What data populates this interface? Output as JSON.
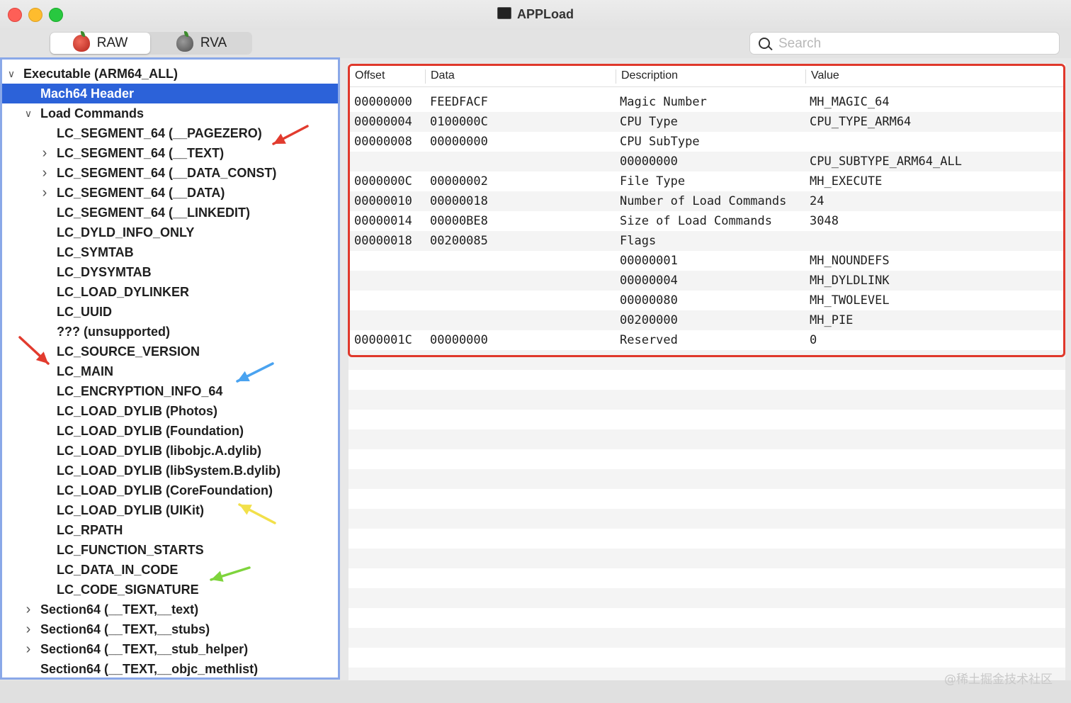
{
  "window": {
    "title": "APPLoad"
  },
  "toolbar": {
    "segments": [
      {
        "label": "RAW",
        "icon": "apple-red-icon",
        "active": true
      },
      {
        "label": "RVA",
        "icon": "apple-gray-icon",
        "active": false
      }
    ],
    "search_placeholder": "Search"
  },
  "tree": {
    "items": [
      {
        "label": "Executable  (ARM64_ALL)",
        "depth": 0,
        "chevron": "expanded"
      },
      {
        "label": "Mach64 Header",
        "depth": 1,
        "chevron": "none",
        "selected": true
      },
      {
        "label": "Load Commands",
        "depth": 1,
        "chevron": "expanded"
      },
      {
        "label": "LC_SEGMENT_64 (__PAGEZERO)",
        "depth": 2,
        "chevron": "none"
      },
      {
        "label": "LC_SEGMENT_64 (__TEXT)",
        "depth": 2,
        "chevron": "collapsed"
      },
      {
        "label": "LC_SEGMENT_64 (__DATA_CONST)",
        "depth": 2,
        "chevron": "collapsed"
      },
      {
        "label": "LC_SEGMENT_64 (__DATA)",
        "depth": 2,
        "chevron": "collapsed"
      },
      {
        "label": "LC_SEGMENT_64 (__LINKEDIT)",
        "depth": 2,
        "chevron": "none"
      },
      {
        "label": "LC_DYLD_INFO_ONLY",
        "depth": 2,
        "chevron": "none"
      },
      {
        "label": "LC_SYMTAB",
        "depth": 2,
        "chevron": "none"
      },
      {
        "label": "LC_DYSYMTAB",
        "depth": 2,
        "chevron": "none"
      },
      {
        "label": "LC_LOAD_DYLINKER",
        "depth": 2,
        "chevron": "none"
      },
      {
        "label": "LC_UUID",
        "depth": 2,
        "chevron": "none"
      },
      {
        "label": "??? (unsupported)",
        "depth": 2,
        "chevron": "none"
      },
      {
        "label": "LC_SOURCE_VERSION",
        "depth": 2,
        "chevron": "none"
      },
      {
        "label": "LC_MAIN",
        "depth": 2,
        "chevron": "none"
      },
      {
        "label": "LC_ENCRYPTION_INFO_64",
        "depth": 2,
        "chevron": "none"
      },
      {
        "label": "LC_LOAD_DYLIB (Photos)",
        "depth": 2,
        "chevron": "none"
      },
      {
        "label": "LC_LOAD_DYLIB (Foundation)",
        "depth": 2,
        "chevron": "none"
      },
      {
        "label": "LC_LOAD_DYLIB (libobjc.A.dylib)",
        "depth": 2,
        "chevron": "none"
      },
      {
        "label": "LC_LOAD_DYLIB (libSystem.B.dylib)",
        "depth": 2,
        "chevron": "none"
      },
      {
        "label": "LC_LOAD_DYLIB (CoreFoundation)",
        "depth": 2,
        "chevron": "none"
      },
      {
        "label": "LC_LOAD_DYLIB (UIKit)",
        "depth": 2,
        "chevron": "none"
      },
      {
        "label": "LC_RPATH",
        "depth": 2,
        "chevron": "none"
      },
      {
        "label": "LC_FUNCTION_STARTS",
        "depth": 2,
        "chevron": "none"
      },
      {
        "label": "LC_DATA_IN_CODE",
        "depth": 2,
        "chevron": "none"
      },
      {
        "label": "LC_CODE_SIGNATURE",
        "depth": 2,
        "chevron": "none"
      },
      {
        "label": "Section64 (__TEXT,__text)",
        "depth": 1,
        "chevron": "collapsed"
      },
      {
        "label": "Section64 (__TEXT,__stubs)",
        "depth": 1,
        "chevron": "collapsed"
      },
      {
        "label": "Section64 (__TEXT,__stub_helper)",
        "depth": 1,
        "chevron": "collapsed"
      },
      {
        "label": "Section64 (__TEXT,__objc_methlist)",
        "depth": 1,
        "chevron": "none"
      }
    ]
  },
  "table": {
    "columns": [
      "Offset",
      "Data",
      "Description",
      "Value"
    ],
    "rows": [
      [
        "00000000",
        "FEEDFACF",
        "Magic Number",
        "MH_MAGIC_64"
      ],
      [
        "00000004",
        "0100000C",
        "CPU Type",
        "CPU_TYPE_ARM64"
      ],
      [
        "00000008",
        "00000000",
        "CPU SubType",
        ""
      ],
      [
        "",
        "",
        "00000000",
        "CPU_SUBTYPE_ARM64_ALL"
      ],
      [
        "0000000C",
        "00000002",
        "File Type",
        "MH_EXECUTE"
      ],
      [
        "00000010",
        "00000018",
        "Number of Load Commands",
        "24"
      ],
      [
        "00000014",
        "00000BE8",
        "Size of Load Commands",
        "3048"
      ],
      [
        "00000018",
        "00200085",
        "Flags",
        ""
      ],
      [
        "",
        "",
        "00000001",
        "MH_NOUNDEFS"
      ],
      [
        "",
        "",
        "00000004",
        "MH_DYLDLINK"
      ],
      [
        "",
        "",
        "00000080",
        "MH_TWOLEVEL"
      ],
      [
        "",
        "",
        "00200000",
        "MH_PIE"
      ],
      [
        "0000001C",
        "00000000",
        "Reserved",
        "0"
      ]
    ]
  },
  "annotations": {
    "arrow_colors": [
      "#e23b2e",
      "#e23b2e",
      "#4aa3f0",
      "#f2e04a",
      "#7ed43c"
    ]
  },
  "watermark": "@稀土掘金技术社区"
}
